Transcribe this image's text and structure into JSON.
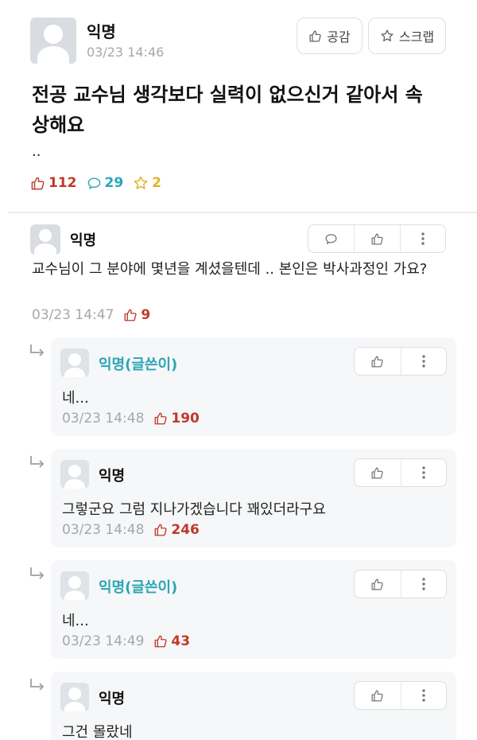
{
  "post": {
    "author": "익명",
    "time": "03/23 14:46",
    "like_button_label": "공감",
    "scrap_button_label": "스크랩",
    "title": "전공 교수님 생각보다 실력이 없으신거 같아서 속상해요",
    "body": "..",
    "stats": {
      "likes": "112",
      "comments": "29",
      "scraps": "2"
    }
  },
  "comment": {
    "author": "익명",
    "text": "교수님이 그 분야에 몇년을 계셨을텐데 .. 본인은 박사과정인 가요?",
    "time": "03/23 14:47",
    "likes": "9"
  },
  "replies": [
    {
      "author": "익명(글쓴이)",
      "is_op": true,
      "text": "네...",
      "time": "03/23 14:48",
      "likes": "190"
    },
    {
      "author": "익명",
      "is_op": false,
      "text": "그렇군요 그럼 지나가겠습니다 꽤있더라구요",
      "time": "03/23 14:48",
      "likes": "246"
    },
    {
      "author": "익명(글쓴이)",
      "is_op": true,
      "text": "네...",
      "time": "03/23 14:49",
      "likes": "43"
    },
    {
      "author": "익명",
      "is_op": false,
      "text": "그건 몰랐네",
      "time": "",
      "likes": ""
    }
  ],
  "colors": {
    "like_red": "#c0392b",
    "comment_teal": "#2aa6b6",
    "scrap_gold": "#e3b22a",
    "muted_gray": "#a3a8ad"
  },
  "icons": {
    "like": "thumbs-up-icon",
    "comment": "speech-bubble-icon",
    "scrap": "star-icon",
    "more": "vertical-dots-icon",
    "reply": "reply-arrow-icon"
  }
}
